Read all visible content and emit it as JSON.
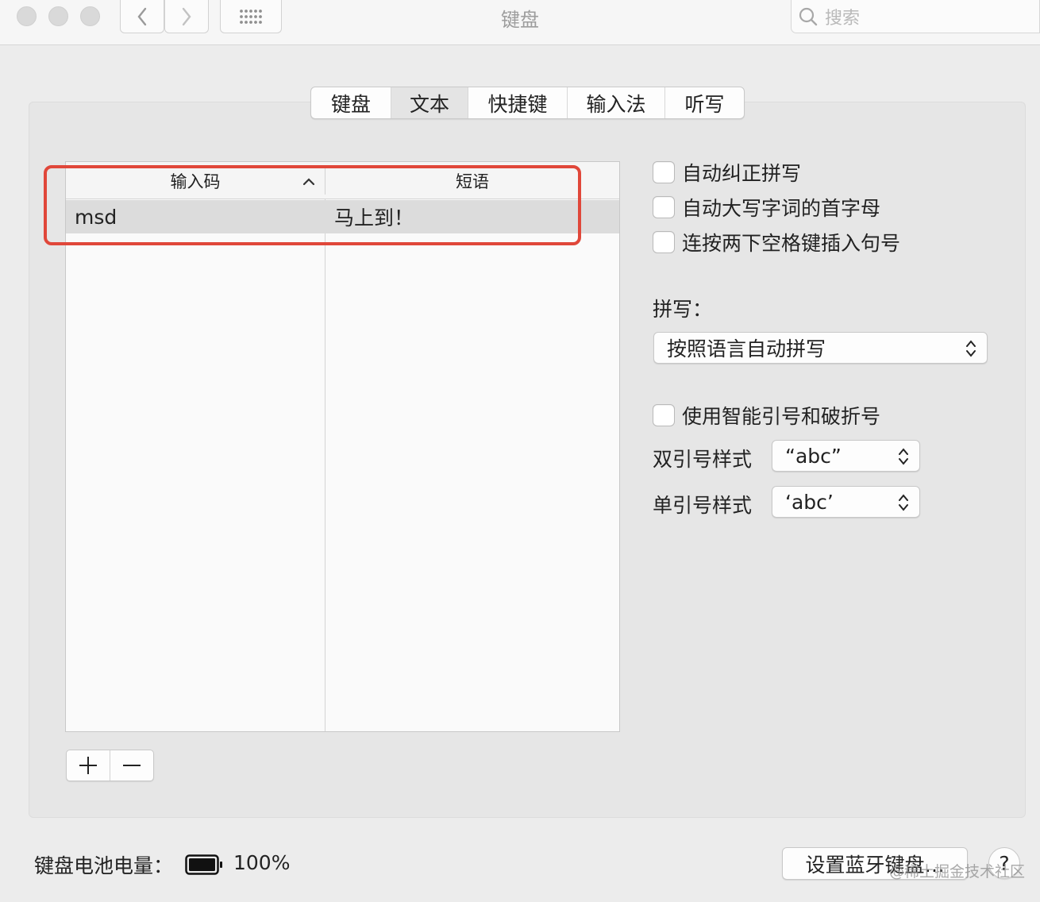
{
  "window": {
    "title": "键盘",
    "search_placeholder": "搜索"
  },
  "tabs": [
    {
      "label": "键盘",
      "active": false
    },
    {
      "label": "文本",
      "active": true
    },
    {
      "label": "快捷键",
      "active": false
    },
    {
      "label": "输入法",
      "active": false
    },
    {
      "label": "听写",
      "active": false
    }
  ],
  "table": {
    "columns": [
      "输入码",
      "短语"
    ],
    "sorted_column": "输入码",
    "rows": [
      {
        "code": "msd",
        "phrase": "马上到！"
      }
    ]
  },
  "options": {
    "auto_correct": {
      "label": "自动纠正拼写",
      "checked": false
    },
    "auto_capitalize": {
      "label": "自动大写字词的首字母",
      "checked": false
    },
    "double_space_period": {
      "label": "连按两下空格键插入句号",
      "checked": false
    },
    "spelling_label": "拼写：",
    "spelling_value": "按照语言自动拼写",
    "smart_quotes": {
      "label": "使用智能引号和破折号",
      "checked": false
    },
    "double_quote_label": "双引号样式",
    "double_quote_value": "“abc”",
    "single_quote_label": "单引号样式",
    "single_quote_value": "‘abc’"
  },
  "footer": {
    "battery_label": "键盘电池电量：",
    "battery_percent": "100%",
    "setup_bluetooth_label": "设置蓝牙键盘…",
    "help_label": "?",
    "watermark": "@稀土掘金技术社区"
  },
  "colors": {
    "highlight": "#e0473a",
    "selected_row": "#dcdcdc",
    "active_tab": "#e4e4e4"
  }
}
